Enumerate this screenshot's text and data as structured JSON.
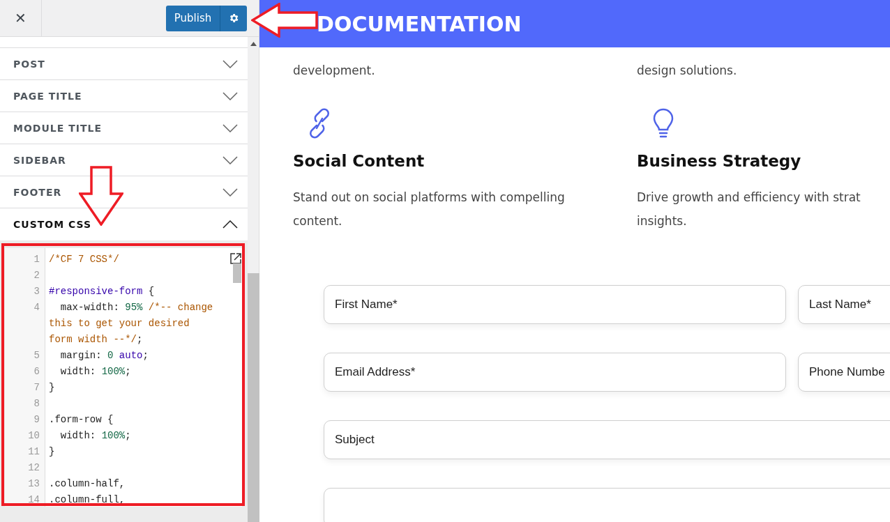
{
  "toolbar": {
    "close": "✕",
    "publish": "Publish"
  },
  "sections": [
    {
      "label": "POST",
      "expanded": false
    },
    {
      "label": "PAGE TITLE",
      "expanded": false
    },
    {
      "label": "MODULE TITLE",
      "expanded": false
    },
    {
      "label": "SIDEBAR",
      "expanded": false
    },
    {
      "label": "FOOTER",
      "expanded": false
    },
    {
      "label": "CUSTOM CSS",
      "expanded": true
    }
  ],
  "editor": {
    "lines": [
      {
        "number": "1",
        "tokens": [
          {
            "kind": "comment",
            "text": "/*CF 7 CSS*/"
          }
        ]
      },
      {
        "number": "2"
      },
      {
        "number": "3",
        "tokens": [
          {
            "kind": "selector",
            "text": "#responsive-form"
          },
          {
            "kind": "plain",
            "text": " {"
          }
        ]
      },
      {
        "number": "4",
        "tokens": [
          {
            "kind": "plain",
            "text": "  max-width: "
          },
          {
            "kind": "number",
            "text": "95% "
          },
          {
            "kind": "comment",
            "text": "/*-- change this to get your desired form width --*/"
          },
          {
            "kind": "plain",
            "text": ";"
          }
        ]
      },
      {
        "number": "5",
        "tokens": [
          {
            "kind": "plain",
            "text": "  margin: "
          },
          {
            "kind": "number",
            "text": "0 "
          },
          {
            "kind": "keyword",
            "text": "auto"
          },
          {
            "kind": "plain",
            "text": ";"
          }
        ]
      },
      {
        "number": "6",
        "tokens": [
          {
            "kind": "plain",
            "text": "  width: "
          },
          {
            "kind": "number",
            "text": "100%"
          },
          {
            "kind": "plain",
            "text": ";"
          }
        ]
      },
      {
        "number": "7",
        "tokens": [
          {
            "kind": "plain",
            "text": "}"
          }
        ]
      },
      {
        "number": "8"
      },
      {
        "number": "9",
        "tokens": [
          {
            "kind": "plain",
            "text": ".form-row {"
          }
        ]
      },
      {
        "number": "10",
        "tokens": [
          {
            "kind": "plain",
            "text": "  width: "
          },
          {
            "kind": "number",
            "text": "100%"
          },
          {
            "kind": "plain",
            "text": ";"
          }
        ]
      },
      {
        "number": "11",
        "tokens": [
          {
            "kind": "plain",
            "text": "}"
          }
        ]
      },
      {
        "number": "12"
      },
      {
        "number": "13",
        "tokens": [
          {
            "kind": "plain",
            "text": ".column-half,"
          }
        ]
      },
      {
        "number": "14",
        "tokens": [
          {
            "kind": "plain",
            "text": ".column-full,"
          }
        ]
      }
    ]
  },
  "preview": {
    "banner": "DOCUMENTATION",
    "columns": [
      {
        "intro": "development.",
        "kind": "link",
        "heading": "Social Content",
        "lines": [
          "Stand out on social platforms with compelling",
          "content."
        ]
      },
      {
        "intro": "design solutions.",
        "kind": "bulb",
        "heading": "Business Strategy",
        "lines": [
          "Drive growth and efficiency with strat",
          "insights."
        ]
      }
    ],
    "form": [
      [
        {
          "placeholder": "First Name*"
        },
        {
          "placeholder": "Last Name*"
        }
      ],
      [
        {
          "placeholder": "Email Address*"
        },
        {
          "placeholder": "Phone Numbe"
        }
      ],
      [
        {
          "placeholder": "Subject"
        }
      ]
    ]
  }
}
